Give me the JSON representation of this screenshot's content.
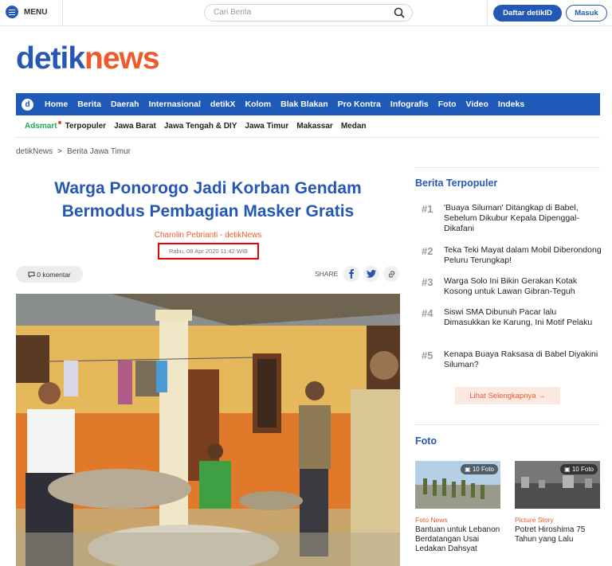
{
  "topbar": {
    "menu_label": "MENU",
    "search_placeholder": "Cari Berita",
    "register_label": "Daftar detikID",
    "login_label": "Masuk"
  },
  "logo": {
    "part1": "detik",
    "part2": "news"
  },
  "nav": {
    "items": [
      "Home",
      "Berita",
      "Daerah",
      "Internasional",
      "detikX",
      "Kolom",
      "Blak Blakan",
      "Pro Kontra",
      "Infografis",
      "Foto",
      "Video",
      "Indeks"
    ]
  },
  "subnav": {
    "adsmart": "Adsmart",
    "items": [
      "Terpopuler",
      "Jawa Barat",
      "Jawa Tengah & DIY",
      "Jawa Timur",
      "Makassar",
      "Medan"
    ]
  },
  "breadcrumb": {
    "root": "detikNews",
    "sep": ">",
    "current": "Berita Jawa Timur"
  },
  "article": {
    "title": "Warga Ponorogo Jadi Korban Gendam Bermodus Pembagian Masker Gratis",
    "author": "Charolin Pebrianti - detikNews",
    "date": "Rabu, 08 Apr 2020 11:42 WIB",
    "comments": "0 komentar",
    "share_label": "SHARE"
  },
  "sidebar": {
    "popular_title": "Berita Terpopuler",
    "popular": [
      {
        "num": "#1",
        "text": "'Buaya Siluman' Ditangkap di Babel, Sebelum Dikubur Kepala Dipenggal-Dikafani"
      },
      {
        "num": "#2",
        "text": "Teka Teki Mayat dalam Mobil Diberondong Peluru Terungkap!"
      },
      {
        "num": "#3",
        "text": "Warga Solo Ini Bikin Gerakan Kotak Kosong untuk Lawan Gibran-Teguh"
      },
      {
        "num": "#4",
        "text": "Siswi SMA Dibunuh Pacar lalu Dimasukkan ke Karung, Ini Motif Pelaku"
      },
      {
        "num": "#5",
        "text": "Kenapa Buaya Raksasa di Babel Diyakini Siluman?"
      }
    ],
    "more_label": "Lihat Selengkapnya →",
    "foto_title": "Foto",
    "fotos": [
      {
        "badge": "10 Foto",
        "category": "Foto News",
        "caption": "Bantuan untuk Lebanon Berdatangan Usai Ledakan Dahsyat"
      },
      {
        "badge": "10 Foto",
        "category": "Picture Story",
        "caption": "Potret Hiroshima 75 Tahun yang Lalu"
      }
    ]
  }
}
